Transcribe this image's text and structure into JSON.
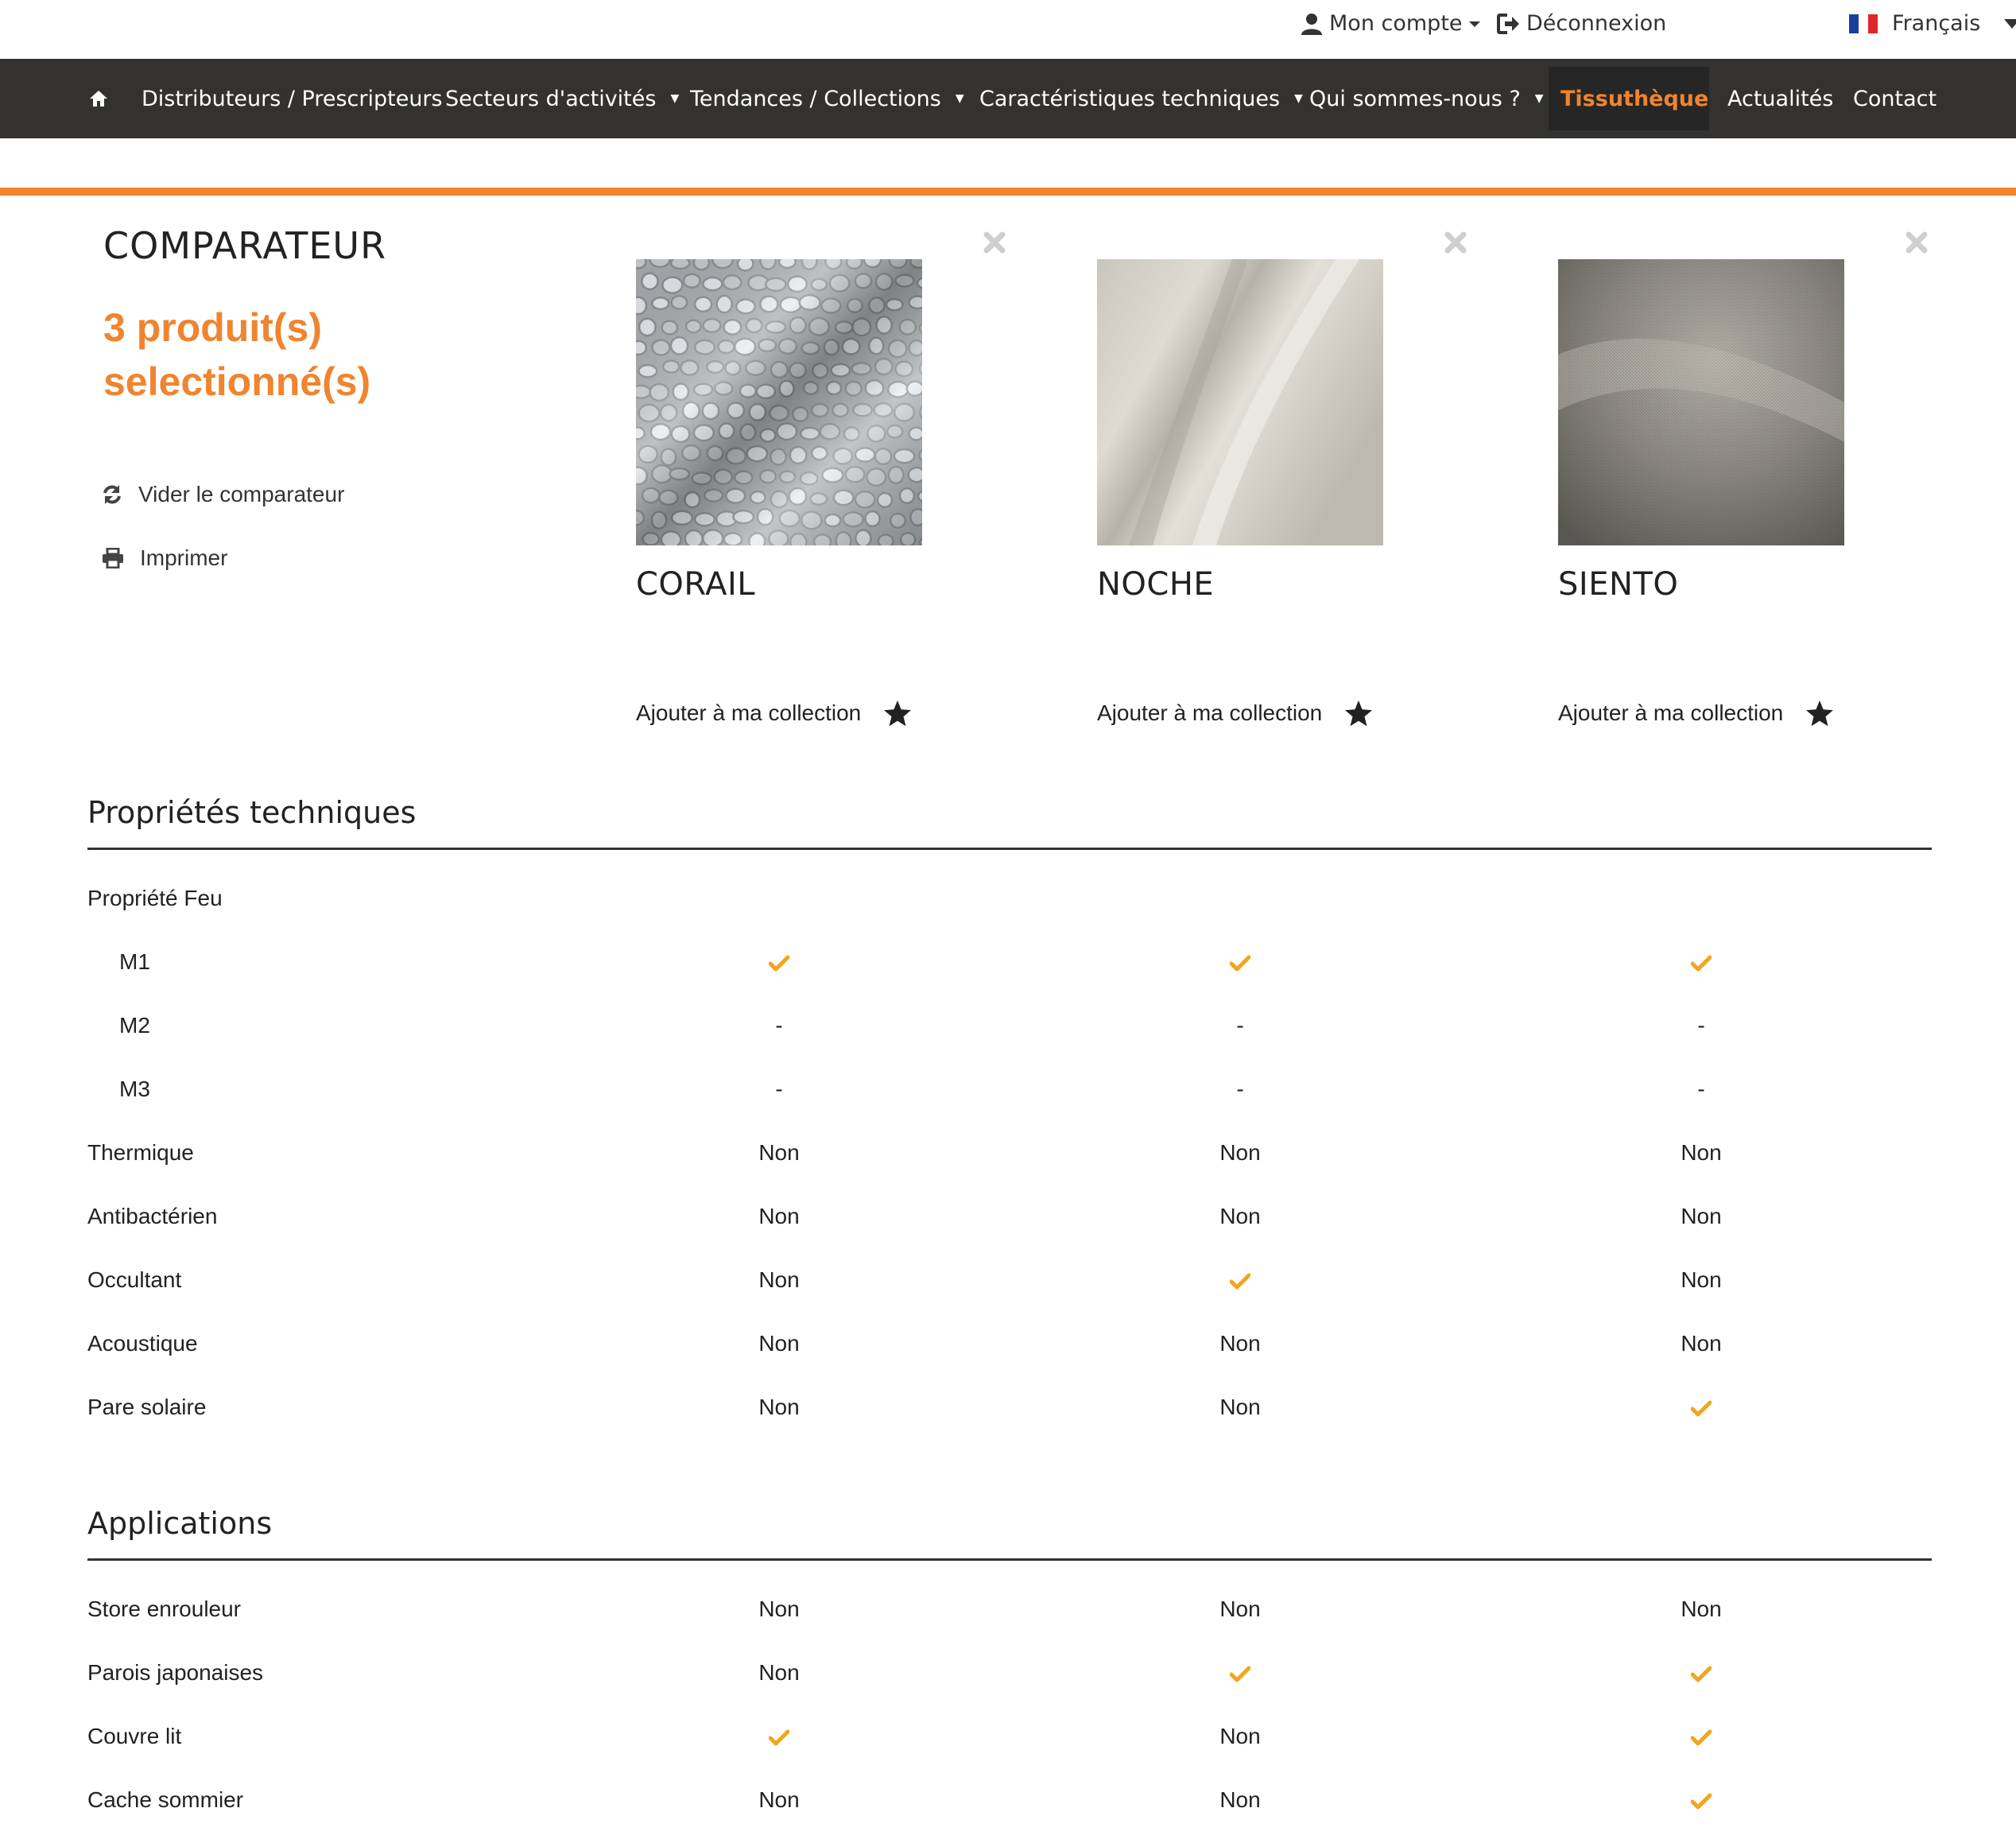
{
  "topbar": {
    "account_label": "Mon compte",
    "logout_label": "Déconnexion",
    "language_label": "Français"
  },
  "nav": {
    "items": [
      {
        "label": "Distributeurs / Prescripteurs"
      },
      {
        "label": "Secteurs d'activités",
        "dropdown": true
      },
      {
        "label": "Tendances / Collections",
        "dropdown": true
      },
      {
        "label": "Caractéristiques techniques",
        "dropdown": true
      },
      {
        "label": "Qui sommes-nous ?",
        "dropdown": true
      },
      {
        "label": "Tissuthèque",
        "active": true
      },
      {
        "label": "Actualités"
      },
      {
        "label": "Contact"
      }
    ]
  },
  "comparator": {
    "title": "COMPARATEUR",
    "count_line1": "3 produit(s)",
    "count_line2": "selectionné(s)",
    "clear_label": "Vider le comparateur",
    "print_label": "Imprimer"
  },
  "products": [
    {
      "name": "CORAIL",
      "add_label": "Ajouter à ma collection",
      "texture": "pebble"
    },
    {
      "name": "NOCHE",
      "add_label": "Ajouter à ma collection",
      "texture": "drape-light"
    },
    {
      "name": "SIENTO",
      "add_label": "Ajouter à ma collection",
      "texture": "drape-dark"
    }
  ],
  "colors": {
    "accent": "#f0842f",
    "check": "#f2a51d",
    "nav_bg": "#333231"
  },
  "sections": [
    {
      "title": "Propriétés techniques",
      "rows": [
        {
          "label": "Propriété Feu",
          "indent": false,
          "values": []
        },
        {
          "label": "M1",
          "indent": true,
          "values": [
            "check",
            "check",
            "check"
          ]
        },
        {
          "label": "M2",
          "indent": true,
          "values": [
            "-",
            "-",
            "-"
          ]
        },
        {
          "label": "M3",
          "indent": true,
          "values": [
            "-",
            "-",
            "-"
          ]
        },
        {
          "label": "Thermique",
          "indent": false,
          "values": [
            "Non",
            "Non",
            "Non"
          ]
        },
        {
          "label": "Antibactérien",
          "indent": false,
          "values": [
            "Non",
            "Non",
            "Non"
          ]
        },
        {
          "label": "Occultant",
          "indent": false,
          "values": [
            "Non",
            "check",
            "Non"
          ]
        },
        {
          "label": "Acoustique",
          "indent": false,
          "values": [
            "Non",
            "Non",
            "Non"
          ]
        },
        {
          "label": "Pare solaire",
          "indent": false,
          "values": [
            "Non",
            "Non",
            "check"
          ]
        }
      ]
    },
    {
      "title": "Applications",
      "rows": [
        {
          "label": "Store enrouleur",
          "indent": false,
          "values": [
            "Non",
            "Non",
            "Non"
          ]
        },
        {
          "label": "Parois japonaises",
          "indent": false,
          "values": [
            "Non",
            "check",
            "check"
          ]
        },
        {
          "label": "Couvre lit",
          "indent": false,
          "values": [
            "check",
            "Non",
            "check"
          ]
        },
        {
          "label": "Cache sommier",
          "indent": false,
          "values": [
            "Non",
            "Non",
            "check"
          ]
        }
      ]
    }
  ]
}
